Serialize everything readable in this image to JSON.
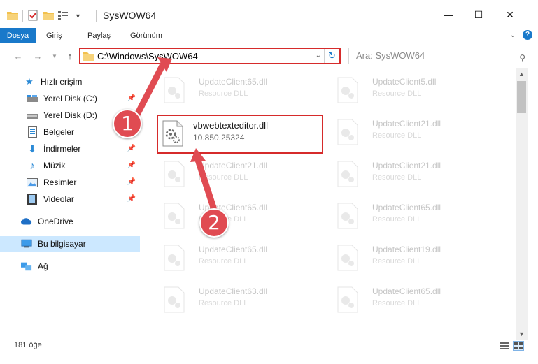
{
  "window": {
    "title": "SysWOW64",
    "controls": {
      "minimize": "—",
      "maximize": "☐",
      "close": "✕"
    }
  },
  "ribbon": {
    "tabs": [
      "Dosya",
      "Giriş",
      "Paylaş",
      "Görünüm"
    ],
    "expand_icon": "chevron-down-icon",
    "help_icon": "help-icon"
  },
  "address": {
    "path": "C:\\Windows\\SysWOW64",
    "search_placeholder": "Ara: SysWOW64"
  },
  "sidebar": {
    "items": [
      {
        "label": "Hızlı erişim",
        "icon": "star-icon",
        "pinned": false
      },
      {
        "label": "Yerel Disk (C:)",
        "icon": "drive-icon",
        "pinned": true
      },
      {
        "label": "Yerel Disk (D:)",
        "icon": "drive-icon",
        "pinned": false
      },
      {
        "label": "Belgeler",
        "icon": "document-icon",
        "pinned": true
      },
      {
        "label": "İndirmeler",
        "icon": "download-icon",
        "pinned": true
      },
      {
        "label": "Müzik",
        "icon": "music-icon",
        "pinned": true
      },
      {
        "label": "Resimler",
        "icon": "pictures-icon",
        "pinned": true
      },
      {
        "label": "Videolar",
        "icon": "video-icon",
        "pinned": true
      },
      {
        "label": "OneDrive",
        "icon": "cloud-icon",
        "pinned": false
      },
      {
        "label": "Bu bilgisayar",
        "icon": "computer-icon",
        "pinned": false,
        "selected": true
      },
      {
        "label": "Ağ",
        "icon": "network-icon",
        "pinned": false
      }
    ]
  },
  "files": {
    "highlighted": {
      "name": "vbwebtexteditor.dll",
      "version": "10.850.25324"
    },
    "faded": [
      {
        "name": "UpdateClient65.dll",
        "type": "Resource DLL"
      },
      {
        "name": "UpdateClient5.dll",
        "type": "Resource DLL"
      },
      {
        "name": "UpdateClient21.dll",
        "type": "Resource DLL"
      },
      {
        "name": "UpdateClient21.dll",
        "type": "Resource DLL"
      },
      {
        "name": "UpdateClient21.dll",
        "type": "Resource DLL"
      },
      {
        "name": "UpdateClient65.dll",
        "type": "Resource DLL"
      },
      {
        "name": "UpdateClient65.dll",
        "type": "Resource DLL"
      },
      {
        "name": "UpdateClient65.dll",
        "type": "Resource DLL"
      },
      {
        "name": "UpdateClient19.dll",
        "type": "Resource DLL"
      },
      {
        "name": "UpdateClient63.dll",
        "type": "Resource DLL"
      },
      {
        "name": "UpdateClient65.dll",
        "type": "Resource DLL"
      }
    ]
  },
  "status": {
    "item_count": "181 öğe"
  },
  "callouts": [
    "1",
    "2"
  ],
  "colors": {
    "accent": "#1979ca",
    "highlight": "#d62b2b",
    "callout": "#e04b52",
    "selected": "#cce8ff"
  }
}
